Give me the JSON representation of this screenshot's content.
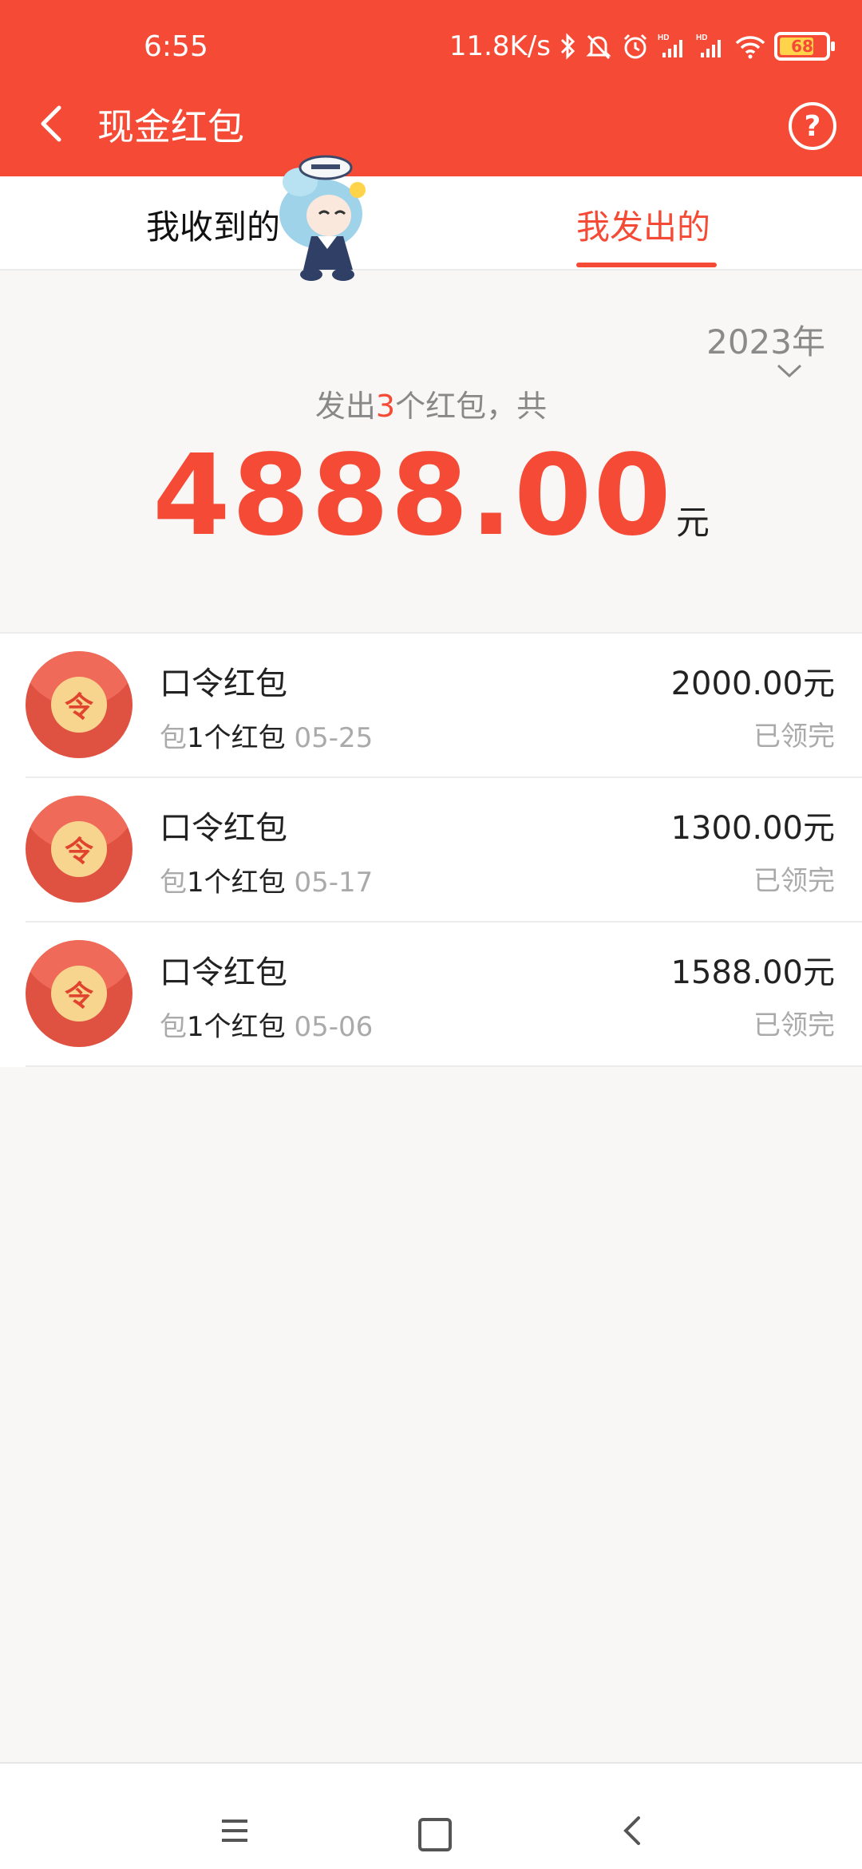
{
  "status_bar": {
    "time": "6:55",
    "net_speed": "11.8K/s",
    "battery": "68"
  },
  "header": {
    "title": "现金红包"
  },
  "tabs": {
    "received": "我收到的",
    "sent": "我发出的"
  },
  "summary": {
    "year": "2023年",
    "prefix": "发出",
    "count": "3",
    "suffix": "个红包，共",
    "total": "4888.00",
    "unit": "元"
  },
  "packets": [
    {
      "name": "口令红包",
      "seal": "令",
      "sub_prefix": "包",
      "count_text": "1个红包",
      "date": "05-25",
      "amount": "2000.00元",
      "status": "已领完"
    },
    {
      "name": "口令红包",
      "seal": "令",
      "sub_prefix": "包",
      "count_text": "1个红包",
      "date": "05-17",
      "amount": "1300.00元",
      "status": "已领完"
    },
    {
      "name": "口令红包",
      "seal": "令",
      "sub_prefix": "包",
      "count_text": "1个红包",
      "date": "05-06",
      "amount": "1588.00元",
      "status": "已领完"
    }
  ],
  "colors": {
    "accent": "#f54b36",
    "background": "#f8f7f5"
  }
}
